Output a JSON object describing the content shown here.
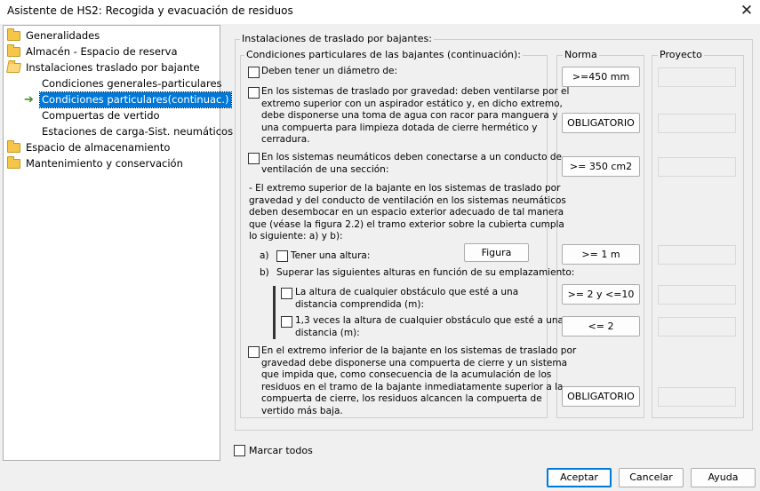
{
  "window": {
    "title": "Asistente de HS2: Recogida y evacuación de residuos",
    "close_glyph": "✕"
  },
  "tree": {
    "items": [
      {
        "label": "Generalidades"
      },
      {
        "label": "Almacén - Espacio de reserva"
      },
      {
        "label": "Instalaciones traslado por bajante"
      },
      {
        "label": "Condiciones generales-particulares"
      },
      {
        "label": "Condiciones particulares(continuac.)"
      },
      {
        "label": "Compuertas de vertido"
      },
      {
        "label": "Estaciones de carga-Sist. neumáticos"
      },
      {
        "label": "Espacio de almacenamiento"
      },
      {
        "label": "Mantenimiento y conservación"
      }
    ],
    "selected_index": 4
  },
  "main": {
    "outer_group_label": "Instalaciones de traslado por bajantes:",
    "inner_group_label": "Condiciones particulares de las bajantes  (continuación):",
    "norma_label": "Norma",
    "proyecto_label": "Proyecto",
    "conditions": {
      "diametro": "Deben tener un diámetro de:",
      "gravedad_lines": [
        "En los sistemas de traslado por gravedad:  deben ventilarse por el",
        "extremo superior con un aspirador estático y, en dicho extremo,",
        "debe disponerse una toma de agua con racor para manguera y",
        "una compuerta para limpieza dotada de cierre hermético y",
        "cerradura."
      ],
      "neumaticos_lines": [
        "En los sistemas neumáticos deben conectarse a un conducto de",
        "ventilación de una sección:"
      ],
      "extremo_superior_lines": [
        "- El extremo superior de la bajante en los sistemas de traslado por",
        "gravedad y del conducto de ventilación en los sistemas neumáticos",
        "deben desembocar en un espacio exterior adecuado de tal manera",
        "que (véase la figura 2.2) el tramo exterior sobre la cubierta cumpla",
        "lo siguiente: a) y b):"
      ],
      "a_prefix": "a)",
      "a_label": "Tener una altura:",
      "figura_button": "Figura",
      "b_prefix": "b)",
      "b_label": "Superar las siguientes alturas en función de su emplazamiento:",
      "b1_lines": [
        "La altura de cualquier obstáculo que esté a una",
        "distancia comprendida (m):"
      ],
      "b2_lines": [
        "1,3 veces la altura de cualquier obstáculo que esté a una",
        "distancia (m):"
      ],
      "extremo_inferior_lines": [
        "En el extremo inferior de la bajante en los sistemas de traslado por",
        "gravedad debe disponerse una compuerta de cierre y un sistema",
        "que impida que, como consecuencia de la acumulación de los",
        "residuos en el tramo de la bajante inmediatamente superior a la",
        "compuerta de cierre, los residuos alcancen la compuerta de",
        "vertido más baja."
      ]
    },
    "norma_values": [
      ">=450 mm",
      "OBLIGATORIO",
      ">= 350 cm2",
      ">= 1 m",
      ">= 2 y <=10",
      "<= 2",
      "OBLIGATORIO"
    ],
    "marcar_todos": "Marcar todos"
  },
  "footer": {
    "accept": "Aceptar",
    "cancel": "Cancelar",
    "help": "Ayuda"
  }
}
